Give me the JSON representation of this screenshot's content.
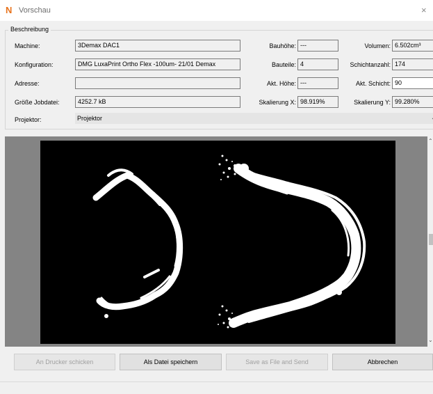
{
  "window": {
    "title": "Vorschau",
    "app_icon": "N",
    "close_glyph": "×"
  },
  "description": {
    "legend": "Beschreibung",
    "machine_label": "Machine:",
    "machine_value": "3Demax DAC1",
    "config_label": "Konfiguration:",
    "config_value": "DMG LuxaPrint Ortho Flex -100um- 21/01 Demax",
    "address_label": "Adresse:",
    "address_value": "",
    "filesize_label": "Größe Jobdatei:",
    "filesize_value": "4252.7 kB",
    "projector_label": "Projektor:",
    "projector_value": "Projektor",
    "build_height_label": "Bauhöhe:",
    "build_height_value": "---",
    "parts_label": "Bauteile:",
    "parts_value": "4",
    "current_height_label": "Akt. Höhe:",
    "current_height_value": "---",
    "scale_x_label": "Skalierung X:",
    "scale_x_value": "98.919%",
    "volume_label": "Volumen:",
    "volume_value": "6.502cm³",
    "layer_count_label": "Schichtanzahl:",
    "layer_count_value": "174",
    "current_layer_label": "Akt. Schicht:",
    "current_layer_value": "90",
    "scale_y_label": "Skalierung Y:",
    "scale_y_value": "99.280%"
  },
  "buttons": {
    "send_printer": "An Drucker schicken",
    "save_file": "Als Datei speichern",
    "save_send": "Save as File and Send",
    "cancel": "Abbrechen"
  },
  "colors": {
    "accent": "#e8731c",
    "preview_bg": "#000000",
    "preview_frame": "#848484"
  },
  "icons": {
    "app": "app-logo-icon",
    "close": "close-icon",
    "dropdown": "chevron-down-icon"
  }
}
